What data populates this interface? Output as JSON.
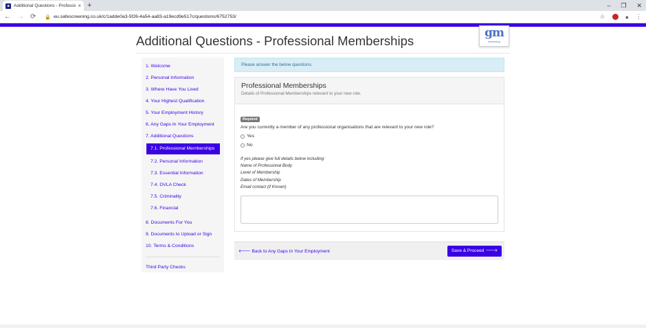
{
  "browser": {
    "tab_title": "Additional Questions - Professio",
    "tab_close": "×",
    "new_tab": "+",
    "url": "eu.safescreening.co.uk/c/1adde0a3-5f26-4a54-aa83-a19ecd9e517c/questions/6752753/",
    "controls": [
      "–",
      "❐",
      "✕"
    ]
  },
  "logo": {
    "mark": "gm",
    "sub": "screening"
  },
  "page_title": "Additional Questions - Professional Memberships",
  "sidebar": {
    "items": [
      "1. Welcome",
      "2. Personal Information",
      "3. Where Have You Lived",
      "4. Your Highest Qualification",
      "5. Your Employment History",
      "6. Any Gaps In Your Employment",
      "7. Additional Questions"
    ],
    "sub_items": [
      "7.1. Professional Memberships",
      "7.2. Personal Information",
      "7.3. Essential Information",
      "7.4. DVLA Check",
      "7.5. Criminality",
      "7.6. Financial"
    ],
    "after_items": [
      "8. Documents For You",
      "9. Documents to Upload or Sign",
      "10. Terms & Conditions"
    ],
    "third_party": "Third Party Checks"
  },
  "alert": "Please answer the below questions.",
  "panel": {
    "title": "Professional Memberships",
    "subtitle": "Details of Professional Memberships relevant to your new role.",
    "required_badge": "Required",
    "question": "Are you currently a member of any professional organisations that are relevant to your new role?",
    "options": [
      "Yes",
      "No"
    ],
    "hint_lines": [
      "If yes please give full details below including:",
      "Name of Professional Body",
      "Level of Membership",
      "Dates of Membership",
      "Email contact (if Known)"
    ],
    "textarea_value": ""
  },
  "footer": {
    "back_label": "Back to Any Gaps In Your Employment",
    "save_label": "Save & Proceed"
  }
}
